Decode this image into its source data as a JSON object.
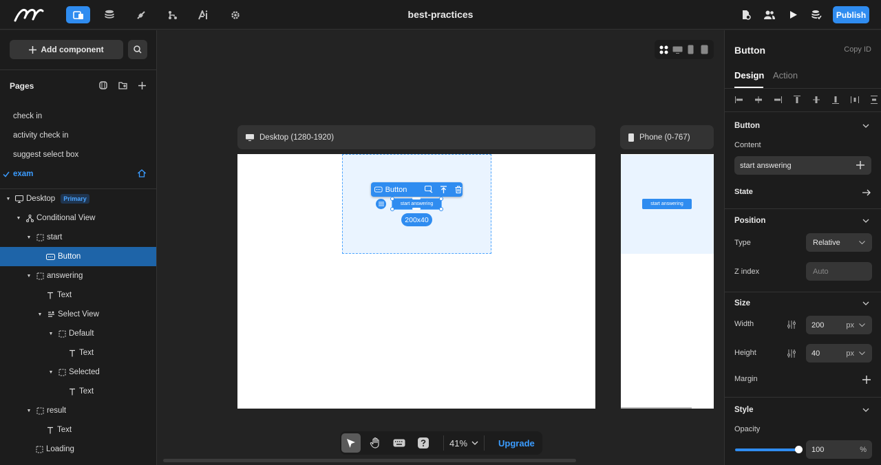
{
  "app": {
    "title": "best-practices",
    "publish_label": "Publish"
  },
  "top_icons": [
    "pages-icon",
    "database-icon",
    "plugin-icon",
    "workflow-icon",
    "ai-icon",
    "settings-icon"
  ],
  "left": {
    "add_component": "Add component",
    "pages_title": "Pages",
    "pages": [
      "check in",
      "activity check in",
      "suggest select box",
      "exam"
    ],
    "active_page": "exam",
    "tree": [
      {
        "label": "Desktop",
        "badge": "Primary"
      },
      {
        "label": "Conditional View"
      },
      {
        "label": "start"
      },
      {
        "label": "Button"
      },
      {
        "label": "answering"
      },
      {
        "label": "Text"
      },
      {
        "label": "Select View"
      },
      {
        "label": "Default"
      },
      {
        "label": "Text"
      },
      {
        "label": "Selected"
      },
      {
        "label": "Text"
      },
      {
        "label": "result"
      },
      {
        "label": "Text"
      },
      {
        "label": "Loading"
      }
    ]
  },
  "canvas": {
    "desktop_label": "Desktop (1280-1920)",
    "phone_label": "Phone (0-767)",
    "toolbar_name": "Button",
    "button_text": "start answering",
    "dimensions": "200x40",
    "zoom": "41%",
    "upgrade": "Upgrade"
  },
  "right": {
    "title": "Button",
    "copy_id": "Copy ID",
    "tabs": [
      "Design",
      "Action"
    ],
    "button_section": "Button",
    "content_label": "Content",
    "content_value": "start answering",
    "state_label": "State",
    "position_section": "Position",
    "type_label": "Type",
    "type_value": "Relative",
    "zindex_label": "Z index",
    "zindex_placeholder": "Auto",
    "size_section": "Size",
    "width_label": "Width",
    "width_value": "200",
    "height_label": "Height",
    "height_value": "40",
    "unit": "px",
    "margin_label": "Margin",
    "style_section": "Style",
    "opacity_label": "Opacity",
    "opacity_value": "100",
    "opacity_unit": "%",
    "opacity_fraction": 1.0
  },
  "colors": {
    "accent": "#2f8cf0",
    "selected_row": "#1e64a8",
    "panel": "#1c1c1c",
    "canvas": "#232323"
  }
}
